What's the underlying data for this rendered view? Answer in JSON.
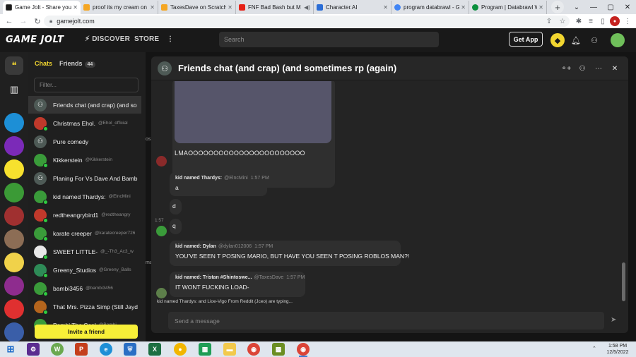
{
  "browser": {
    "tabs": [
      {
        "label": "Game Jolt - Share your c",
        "favicon_color": "#1a1a1a",
        "active": true
      },
      {
        "label": "proof its my cream on Sc",
        "favicon_color": "#f5a623",
        "active": false
      },
      {
        "label": "TaxesDave on Scratch",
        "favicon_color": "#f5a623",
        "active": false
      },
      {
        "label": "FNF Bad Bash but M",
        "favicon_color": "#e62117",
        "active": false
      },
      {
        "label": "Character.AI",
        "favicon_color": "#2b6dd6",
        "active": false
      },
      {
        "label": "program databrawl - Go",
        "favicon_color": "#4285f4",
        "active": false
      },
      {
        "label": "Program | Databrawl Wik",
        "favicon_color": "#0a8f3d",
        "active": false
      }
    ],
    "url": "gamejolt.com"
  },
  "gamejolt": {
    "logo": "GAME JOLT",
    "nav": {
      "discover": "DISCOVER",
      "store": "STORE"
    },
    "search_placeholder": "Search",
    "get_app": "Get App"
  },
  "chat_panel": {
    "tab_chats": "Chats",
    "tab_friends": "Friends",
    "friends_count": "44",
    "filter_placeholder": "Filter...",
    "invite_label": "Invite a friend",
    "items": [
      {
        "name": "Friends chat (and crap) (and so",
        "handle": "",
        "avatar_color": "#4e5a56",
        "group": true,
        "online": false
      },
      {
        "name": "Christmas Ehol.",
        "handle": "@Ehol_official",
        "avatar_color": "#c0392b",
        "group": false,
        "online": true
      },
      {
        "name": "Pure comedy",
        "handle": "",
        "avatar_color": "#4e5a56",
        "group": true,
        "online": false
      },
      {
        "name": "Kikkerstein",
        "handle": "@Kikkerstein",
        "avatar_color": "#3a9b3a",
        "group": false,
        "online": true
      },
      {
        "name": "Planing For Vs Dave And Bamb",
        "handle": "",
        "avatar_color": "#4e5a56",
        "group": true,
        "online": false
      },
      {
        "name": "kid named Thardys:",
        "handle": "@ElncMini",
        "avatar_color": "#3a9b3a",
        "group": false,
        "online": true
      },
      {
        "name": "redtheangrybird1",
        "handle": "@redtheangry",
        "avatar_color": "#c0392b",
        "group": false,
        "online": true
      },
      {
        "name": "karate creeper",
        "handle": "@karatecreeper726",
        "avatar_color": "#3a9b3a",
        "group": false,
        "online": true
      },
      {
        "name": "SWEET LITTLE-",
        "handle": "@_-Th3_Ac3_w",
        "avatar_color": "#e8e8e8",
        "group": false,
        "online": true
      },
      {
        "name": "Greeny_Studios",
        "handle": "@Greeny_Balls",
        "avatar_color": "#2e8b57",
        "group": false,
        "online": true
      },
      {
        "name": "bambi3456",
        "handle": "@bambi3456",
        "avatar_color": "#3a9b3a",
        "group": false,
        "online": true
      },
      {
        "name": "That Mrs. Pizza Simp (Still Jayd",
        "handle": "",
        "avatar_color": "#b5651d",
        "group": false,
        "online": true
      },
      {
        "name": "Bambi The Cool",
        "handle": "@Bambi",
        "avatar_color": "#3a9b3a",
        "group": false,
        "online": true
      }
    ]
  },
  "chat": {
    "title": "Friends chat (and crap) (and sometimes rp (again)",
    "image_message_text": "LMAOOOOOOOOOOOOOOOOOOOOOOO",
    "messages": [
      {
        "author": "kid named Thardys:",
        "handle": "@ElncMini",
        "time": "1:57 PM",
        "lines": [
          "a",
          "d",
          "q"
        ]
      },
      {
        "author": "kid named: Dylan",
        "handle": "@dylan012006",
        "time": "1:57 PM",
        "lines": [
          "YOU'VE SEEN T POSING MARIO, BUT HAVE YOU SEEN T POSING ROBLOS MAN?!"
        ]
      },
      {
        "author": "kid named: Tristan #Shintoswe...",
        "handle": "@TaxesDave",
        "time": "1:57 PM",
        "lines": [
          "IT WONT FUCKING LOAD-"
        ]
      }
    ],
    "side_time": "1:57",
    "typing_indicator": "kid named Thardys: and Lioe-Vigo From Reddit (Jceo) are typing...",
    "composer_placeholder": "Send a message"
  },
  "background_page": {
    "snippet_1": "os",
    "snippet_2": "ma"
  },
  "taskbar": {
    "time": "1:58 PM",
    "date": "12/5/2022"
  }
}
